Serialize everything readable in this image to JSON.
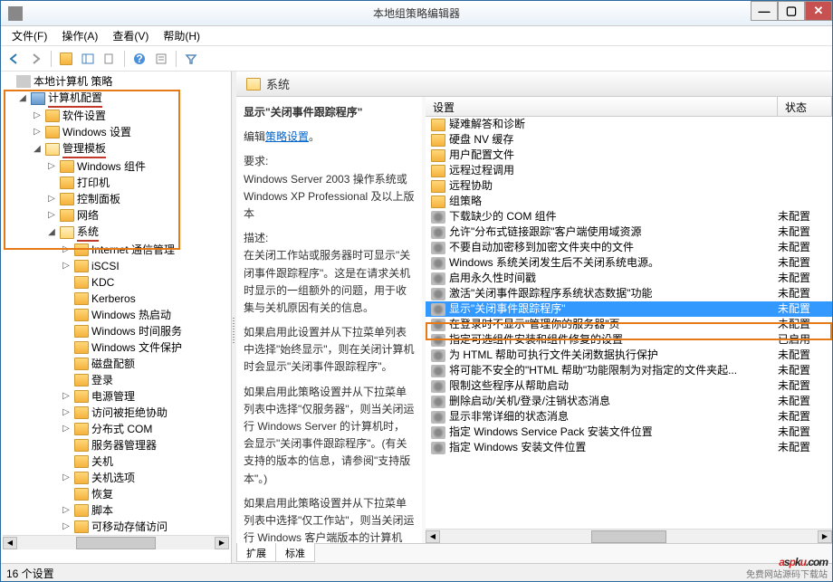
{
  "window": {
    "title": "本地组策略编辑器"
  },
  "menu": {
    "file": "文件(F)",
    "action": "操作(A)",
    "view": "查看(V)",
    "help": "帮助(H)"
  },
  "tree": {
    "root": "本地计算机 策略",
    "computer_config": "计算机配置",
    "software_settings": "软件设置",
    "windows_settings": "Windows 设置",
    "admin_templates": "管理模板",
    "windows_components": "Windows 组件",
    "printers": "打印机",
    "control_panel": "控制面板",
    "network": "网络",
    "system": "系统",
    "internet_comm": "Internet 通信管理",
    "iscsi": "iSCSI",
    "kdc": "KDC",
    "kerberos": "Kerberos",
    "windows_hotstart": "Windows 热启动",
    "windows_time": "Windows 时间服务",
    "windows_file_protect": "Windows 文件保护",
    "disk_quota": "磁盘配额",
    "logon": "登录",
    "power_mgmt": "电源管理",
    "dial_help": "访问被拒绝协助",
    "distributed_com": "分布式 COM",
    "server_manager": "服务器管理器",
    "shutdown": "关机",
    "shutdown_opts": "关机选项",
    "recovery": "恢复",
    "scripts": "脚本",
    "removable_storage": "可移动存储访问"
  },
  "right_header": {
    "title": "系统"
  },
  "description": {
    "title": "显示\"关闭事件跟踪程序\"",
    "edit_link_prefix": "编辑",
    "edit_link": "策略设置",
    "requirements_label": "要求:",
    "requirements": "Windows Server 2003 操作系统或 Windows XP Professional 及以上版本",
    "desc_label": "描述:",
    "desc1": "在关闭工作站或服务器时可显示\"关闭事件跟踪程序\"。这是在请求关机时显示的一组额外的问题，用于收集与关机原因有关的信息。",
    "desc2": "如果启用此设置并从下拉菜单列表中选择\"始终显示\"，则在关闭计算机时会显示\"关闭事件跟踪程序\"。",
    "desc3": "如果启用此策略设置并从下拉菜单列表中选择\"仅服务器\"，则当关闭运行 Windows Server 的计算机时，会显示\"关闭事件跟踪程序\"。(有关支持的版本的信息，请参阅\"支持版本\"。)",
    "desc4": "如果启用此策略设置并从下拉菜单列表中选择\"仅工作站\"，则当关闭运行 Windows 客户端版本的计算机时，会显示\"关闭事件跟踪程序\"。(有关支持的版本的信息，请"
  },
  "list": {
    "col_setting": "设置",
    "col_status": "状态",
    "folders": [
      "疑难解答和诊断",
      "硬盘 NV 缓存",
      "用户配置文件",
      "远程过程调用",
      "远程协助",
      "组策略"
    ],
    "policies": [
      {
        "name": "下载缺少的 COM 组件",
        "status": "未配置"
      },
      {
        "name": "允许\"分布式链接跟踪\"客户端使用域资源",
        "status": "未配置"
      },
      {
        "name": "不要自动加密移到加密文件夹中的文件",
        "status": "未配置"
      },
      {
        "name": "Windows 系统关闭发生后不关闭系统电源。",
        "status": "未配置"
      },
      {
        "name": "启用永久性时间戳",
        "status": "未配置"
      },
      {
        "name": "激活\"关闭事件跟踪程序系统状态数据\"功能",
        "status": "未配置"
      },
      {
        "name": "显示\"关闭事件跟踪程序\"",
        "status": "未配置",
        "selected": true
      },
      {
        "name": "在登录时不显示\"管理你的服务器\"页",
        "status": "未配置"
      },
      {
        "name": "指定可选组件安装和组件修复的设置",
        "status": "已启用"
      },
      {
        "name": "为 HTML 帮助可执行文件关闭数据执行保护",
        "status": "未配置"
      },
      {
        "name": "将可能不安全的\"HTML 帮助\"功能限制为对指定的文件夹起...",
        "status": "未配置"
      },
      {
        "name": "限制这些程序从帮助启动",
        "status": "未配置"
      },
      {
        "name": "删除启动/关机/登录/注销状态消息",
        "status": "未配置"
      },
      {
        "name": "显示非常详细的状态消息",
        "status": "未配置"
      },
      {
        "name": "指定 Windows Service Pack 安装文件位置",
        "status": "未配置"
      },
      {
        "name": "指定 Windows 安装文件位置",
        "status": "未配置"
      }
    ]
  },
  "tabs": {
    "extended": "扩展",
    "standard": "标准"
  },
  "statusbar": {
    "text": "16 个设置"
  },
  "watermark": {
    "main": "aspku.com",
    "sub": "免费网站源码下载站"
  }
}
